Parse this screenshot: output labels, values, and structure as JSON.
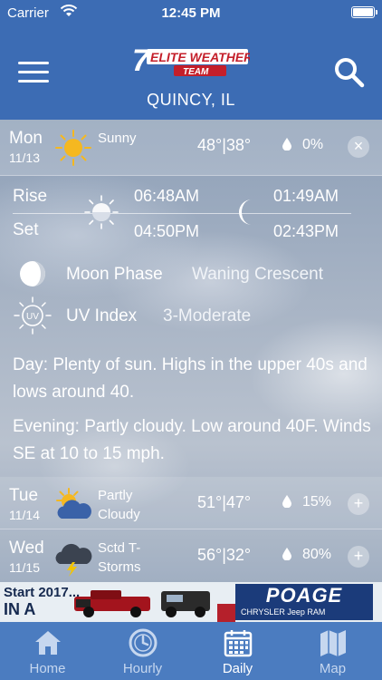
{
  "status_bar": {
    "carrier": "Carrier",
    "time": "12:45 PM"
  },
  "header": {
    "logo_text": "ELITE WEATHER",
    "logo_sub": "TEAM",
    "logo_number": "7",
    "location": "QUINCY, IL"
  },
  "selected_day": {
    "day": "Mon",
    "date": "11/13",
    "condition": "Sunny",
    "temps": "48°|38°",
    "precip": "0%",
    "toggle": "×",
    "sun": {
      "rise_label": "Rise",
      "set_label": "Set",
      "rise": "06:48AM",
      "set": "04:50PM"
    },
    "moon": {
      "rise": "01:49AM",
      "set": "02:43PM"
    },
    "moon_phase": {
      "label": "Moon Phase",
      "value": "Waning Crescent"
    },
    "uv": {
      "icon_text": "UV",
      "label": "UV Index",
      "value": "3-Moderate"
    },
    "description_day": "Day: Plenty of sun. Highs in the upper 40s and lows around 40.",
    "description_evening": "Evening: Partly cloudy. Low around 40F. Winds SE at 10 to 15 mph."
  },
  "days": [
    {
      "day": "Tue",
      "date": "11/14",
      "condition_line1": "Partly",
      "condition_line2": "Cloudy",
      "temps": "51°|47°",
      "precip": "15%",
      "toggle": "+"
    },
    {
      "day": "Wed",
      "date": "11/15",
      "condition_line1": "Sctd T-",
      "condition_line2": "Storms",
      "temps": "56°|32°",
      "precip": "80%",
      "toggle": "+"
    }
  ],
  "ad": {
    "line1": "Start 2017...",
    "line2": "IN A",
    "brand": "POAGE",
    "brand_sub": "CHRYSLER  Jeep  RAM"
  },
  "tabs": [
    {
      "label": "Home",
      "icon": "home-icon",
      "active": false
    },
    {
      "label": "Hourly",
      "icon": "clock-icon",
      "active": false
    },
    {
      "label": "Daily",
      "icon": "calendar-icon",
      "active": true
    },
    {
      "label": "Map",
      "icon": "map-icon",
      "active": false
    }
  ],
  "colors": {
    "header": "#3c6cb4",
    "tabbar": "#4b7cc0",
    "sun": "#f5b820",
    "storm_bolt": "#f2c400"
  }
}
